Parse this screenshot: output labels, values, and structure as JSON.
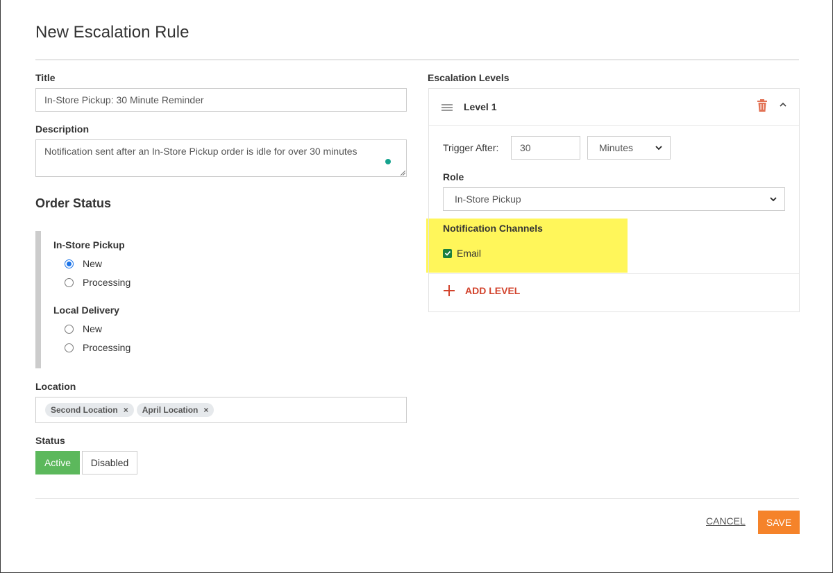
{
  "modal": {
    "title": "New Escalation Rule"
  },
  "form": {
    "title_label": "Title",
    "title_value": "In-Store Pickup: 30 Minute Reminder",
    "description_label": "Description",
    "description_value": "Notification sent after an In-Store Pickup order is idle for over 30 minutes",
    "order_status_heading": "Order Status",
    "groups": [
      {
        "label": "In-Store Pickup",
        "options": [
          "New",
          "Processing"
        ],
        "selected": "New"
      },
      {
        "label": "Local Delivery",
        "options": [
          "New",
          "Processing"
        ],
        "selected": null
      }
    ],
    "location_label": "Location",
    "locations": [
      "Second Location",
      "April Location"
    ],
    "tag_remove_glyph": "×",
    "status_label": "Status",
    "status_active": "Active",
    "status_disabled": "Disabled",
    "status_selected": "Active"
  },
  "escalation": {
    "heading": "Escalation Levels",
    "level_title": "Level 1",
    "trigger_label": "Trigger After:",
    "trigger_value": "30",
    "trigger_unit": "Minutes",
    "role_label": "Role",
    "role_value": "In-Store Pickup",
    "channels_label": "Notification Channels",
    "channel_email": "Email",
    "channel_email_checked": true,
    "add_level": "ADD LEVEL"
  },
  "footer": {
    "cancel": "CANCEL",
    "save": "SAVE"
  },
  "colors": {
    "accent_orange": "#f5832a",
    "active_green": "#5cb85c",
    "danger_red": "#d2432c",
    "highlight_yellow": "#fff65a",
    "checkbox_green": "#1b7f3f"
  }
}
